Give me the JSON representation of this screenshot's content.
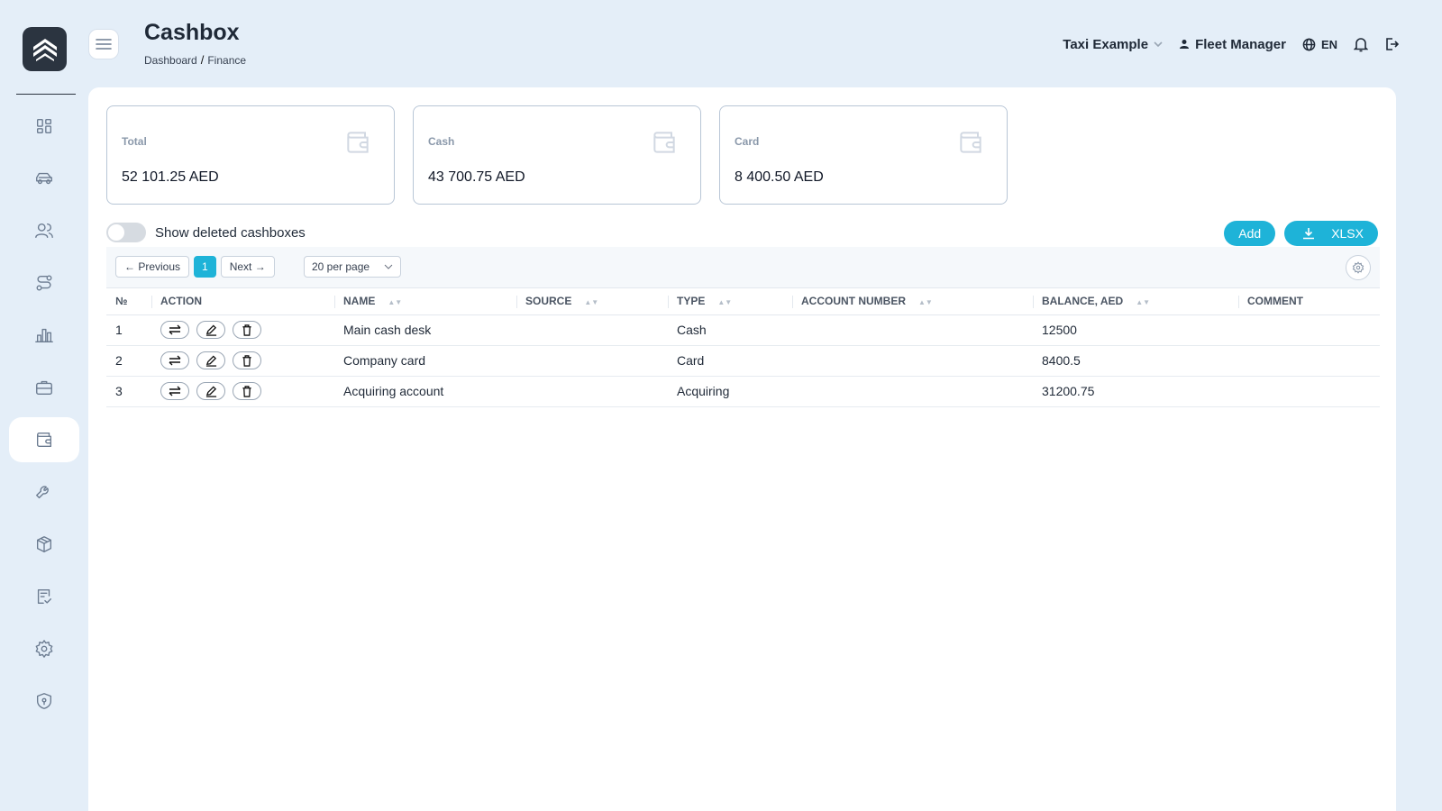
{
  "header": {
    "title": "Cashbox",
    "breadcrumb": [
      "Dashboard",
      "Finance"
    ],
    "breadcrumb_sep": "/",
    "company": "Taxi Example",
    "user": "Fleet Manager",
    "language": "EN"
  },
  "sidebar": {
    "items": [
      {
        "icon": "dashboard-icon"
      },
      {
        "icon": "car-icon"
      },
      {
        "icon": "users-icon"
      },
      {
        "icon": "route-icon"
      },
      {
        "icon": "chart-icon"
      },
      {
        "icon": "briefcase-icon"
      },
      {
        "icon": "wallet-icon",
        "active": true
      },
      {
        "icon": "wrench-icon"
      },
      {
        "icon": "box-icon"
      },
      {
        "icon": "checklist-icon"
      },
      {
        "icon": "gear-icon"
      },
      {
        "icon": "shield-icon"
      }
    ]
  },
  "cards": [
    {
      "label": "Total",
      "value": "52 101.25 AED"
    },
    {
      "label": "Cash",
      "value": "43 700.75 AED"
    },
    {
      "label": "Card",
      "value": "8 400.50 AED"
    }
  ],
  "toggle": {
    "label": "Show deleted cashboxes",
    "on": false
  },
  "actions": {
    "add_label": "Add",
    "export_label": "XLSX"
  },
  "pager": {
    "prev": "← Previous",
    "page": "1",
    "next": "Next →",
    "per_page": "20 per page"
  },
  "table": {
    "columns": [
      "№",
      "ACTION",
      "NAME",
      "SOURCE",
      "TYPE",
      "ACCOUNT NUMBER",
      "BALANCE, AED",
      "COMMENT"
    ],
    "rows": [
      {
        "num": "1",
        "name": "Main cash desk",
        "source": "",
        "type": "Cash",
        "account": "",
        "balance": "12500",
        "comment": ""
      },
      {
        "num": "2",
        "name": "Company card",
        "source": "",
        "type": "Card",
        "account": "",
        "balance": "8400.5",
        "comment": ""
      },
      {
        "num": "3",
        "name": "Acquiring account",
        "source": "",
        "type": "Acquiring",
        "account": "",
        "balance": "31200.75",
        "comment": ""
      }
    ]
  },
  "colors": {
    "accent": "#1eb3d8",
    "background": "#e4eef8",
    "logo_bg": "#2b3440"
  }
}
